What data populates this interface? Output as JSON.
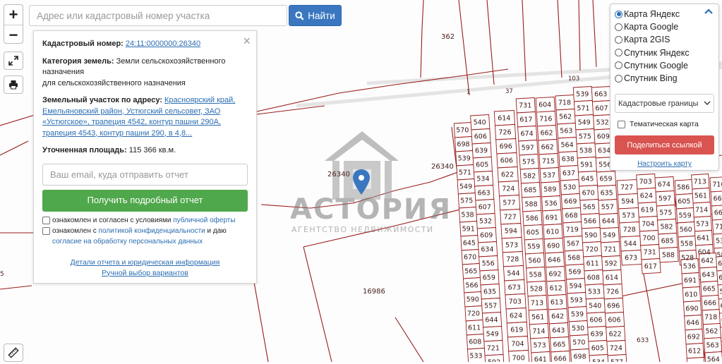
{
  "search": {
    "placeholder": "Адрес или кадастровый номер участка",
    "button_label": "Найти"
  },
  "zoom": {
    "in_label": "+",
    "out_label": "−"
  },
  "info": {
    "cadastral_label": "Кадастровый номер:",
    "cadastral_value": "24:11:0000000:26340",
    "category_label": "Категория земель:",
    "category_value": "Земли сельскохозяйственного назначения",
    "category_extra": "для сельскохозяйственного назначения",
    "address_label": "Земельный участок по адресу:",
    "address_value": "Красноярский край, Емельяновский район, Устюгский сельсовет, ЗАО «Устюгское», трапеция 4542, контур пашни 290А, трапеция 4543, контур пашни 290, в 4,8...",
    "area_label": "Уточненная площадь:",
    "area_value": "115 366 кв.м.",
    "email_placeholder": "Ваш email, куда отправить отчет",
    "report_button": "Получить подробный отчет",
    "consent1_text": "ознакомлен и согласен с условиями",
    "consent1_link": "публичной оферты",
    "consent2_text": "ознакомлен с",
    "consent2_link": "политикой конфиденциальности",
    "consent2_mid": "и даю",
    "consent2_link2": "согласие на обработку персональных данных",
    "details_link": "Детали отчета и юридическая информация",
    "manual_link": "Ручной выбор вариантов"
  },
  "layers": {
    "options": [
      "Карта Яндекс",
      "Карта Google",
      "Карта 2GIS",
      "Спутник Яндекс",
      "Спутник Google",
      "Спутник Bing"
    ],
    "selected_index": 0,
    "select_value": "Кадастровые границы",
    "thematic_label": "Тематическая карта",
    "share_button": "Поделиться ссылкой",
    "setup_link": "Настроить карту"
  },
  "watermark": {
    "title": "АСТОРИЯ",
    "subtitle": "АГЕНТСТВО НЕДВИЖИМОСТИ"
  },
  "map": {
    "labels": [
      "362",
      "26340",
      "26340",
      "16986",
      "103",
      "1",
      "37",
      "5",
      "633"
    ],
    "parcel_numbers": [
      "570",
      "698",
      "539",
      "571",
      "549",
      "575",
      "538",
      "591",
      "645",
      "670",
      "565",
      "566",
      "590",
      "720",
      "611",
      "608",
      "533",
      "540",
      "606",
      "639",
      "605",
      "534",
      "663",
      "607",
      "532",
      "609",
      "634",
      "556",
      "659",
      "635",
      "557",
      "644",
      "549",
      "721",
      "592",
      "614",
      "726",
      "696",
      "606",
      "622",
      "724",
      "577",
      "727",
      "594",
      "573",
      "728",
      "544",
      "673",
      "703",
      "624",
      "619",
      "704",
      "700",
      "731",
      "617",
      "674",
      "597",
      "575",
      "582",
      "685",
      "588",
      "586",
      "605",
      "559",
      "560",
      "558",
      "528",
      "713",
      "561",
      "714",
      "573",
      "641",
      "604",
      "716",
      "662",
      "662",
      "715",
      "537",
      "589",
      "536",
      "691",
      "610",
      "690",
      "646",
      "692",
      "612",
      "613",
      "642",
      "643",
      "665",
      "666",
      "718",
      "562",
      "563",
      "564",
      "638",
      "637",
      "530",
      "669",
      "668",
      "719",
      "567",
      "568",
      "569",
      "594",
      "593",
      "539",
      "530"
    ]
  }
}
